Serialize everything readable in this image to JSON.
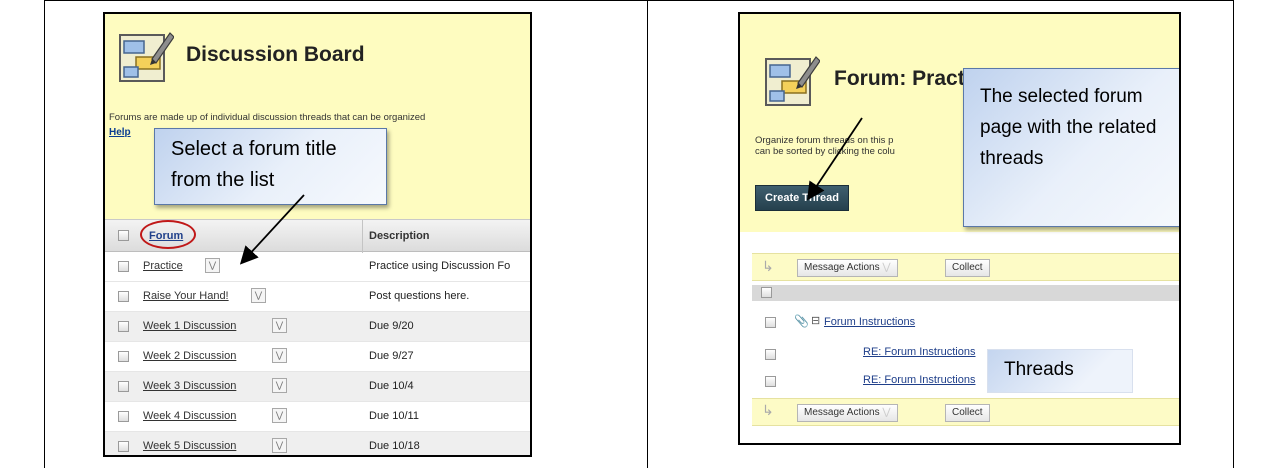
{
  "left_panel": {
    "title": "Discussion Board",
    "intro_text": "Forums are made up of individual discussion threads that can be organized",
    "help_link": "Help",
    "callout": "Select a forum title from the list",
    "columns": {
      "forum": "Forum",
      "description": "Description"
    },
    "forums": [
      {
        "name": "Practice",
        "description": "Practice using Discussion Fo"
      },
      {
        "name": "Raise Your Hand!",
        "description": "Post questions here."
      },
      {
        "name": "Week 1 Discussion",
        "description": "Due 9/20"
      },
      {
        "name": "Week 2 Discussion",
        "description": "Due 9/27"
      },
      {
        "name": "Week 3 Discussion",
        "description": "Due 10/4"
      },
      {
        "name": "Week 4 Discussion",
        "description": "Due 10/11"
      },
      {
        "name": "Week 5 Discussion",
        "description": "Due 10/18"
      }
    ]
  },
  "right_panel": {
    "title": "Forum: Practice",
    "intro_line1": "Organize forum threads on this p",
    "intro_line2": "can be sorted by clicking the colu",
    "create_thread_label": "Create Thread",
    "callout": "The selected forum page with the related threads",
    "message_actions_label": "Message Actions",
    "collect_label": "Collect",
    "threads": [
      {
        "title": "Forum Instructions"
      },
      {
        "title": "RE: Forum Instructions"
      },
      {
        "title": "RE: Forum Instructions"
      }
    ],
    "threads_label": "Threads"
  },
  "colors": {
    "header_band": "#fefcc0",
    "callout_border": "#5a78a8",
    "highlight_oval": "#c01818",
    "create_thread_button": "#2e4c5a"
  }
}
